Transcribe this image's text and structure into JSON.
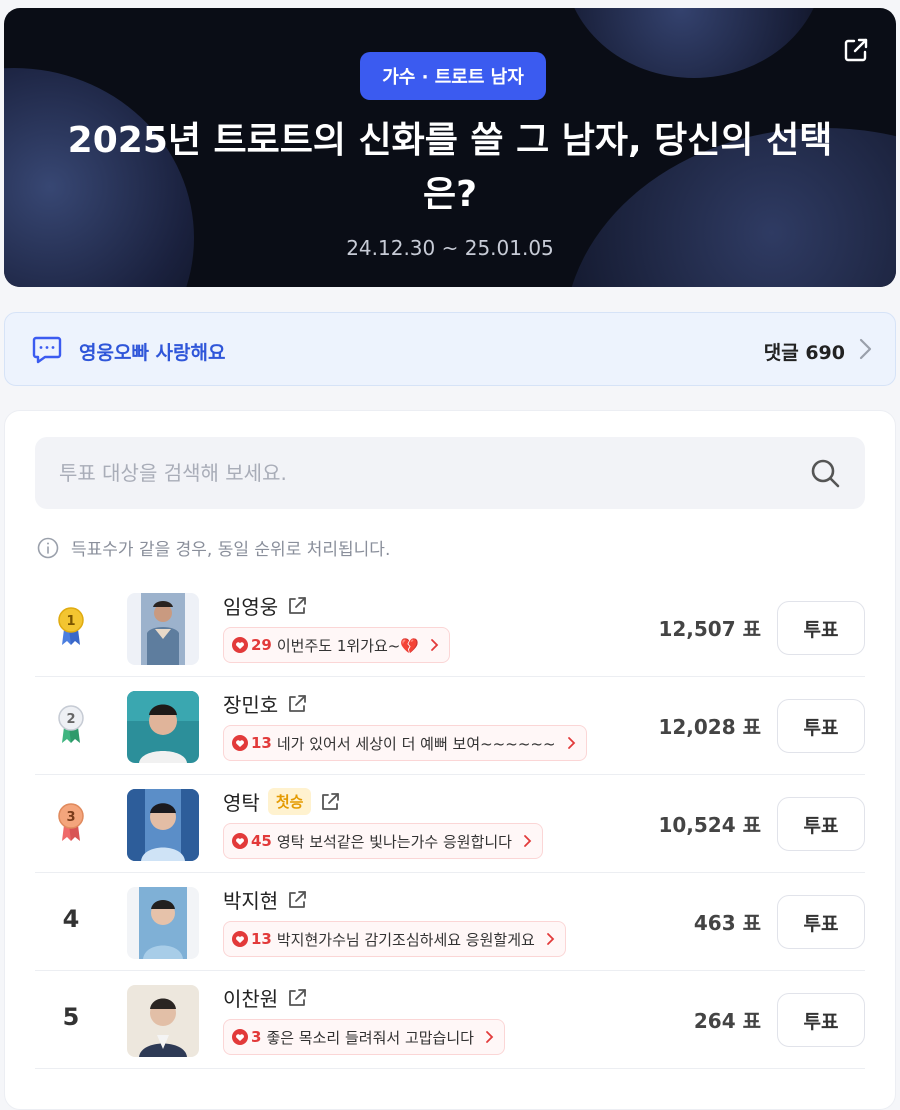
{
  "hero": {
    "category": "가수 · 트로트 남자",
    "title": "2025년 트로트의 신화를 쓸 그 남자, 당신의 선택은?",
    "dates": "24.12.30 ~ 25.01.05"
  },
  "comment_bar": {
    "message": "영웅오빠 사랑해요",
    "count_label": "댓글 690"
  },
  "search": {
    "placeholder": "투표 대상을 검색해 보세요."
  },
  "notice": "득표수가 같을 경우, 동일 순위로 처리됩니다.",
  "vote_label": "투표",
  "candidates": [
    {
      "rank": "1",
      "name": "임영웅",
      "badge": "",
      "comment_count": "29",
      "comment": "이번주도 1위가요~💔",
      "votes": "12,507 표",
      "medal_color": "#f3c531"
    },
    {
      "rank": "2",
      "name": "장민호",
      "badge": "",
      "comment_count": "13",
      "comment": "네가 있어서 세상이 더 예뻐 보여~~~~~~",
      "votes": "12,028 표",
      "medal_color": "#dfe3ea"
    },
    {
      "rank": "3",
      "name": "영탁",
      "badge": "첫승",
      "comment_count": "45",
      "comment": "영탁 보석같은 빛나는가수 응원합니다",
      "votes": "10,524 표",
      "medal_color": "#f4a57c"
    },
    {
      "rank": "4",
      "name": "박지현",
      "badge": "",
      "comment_count": "13",
      "comment": "박지현가수님 감기조심하세요 응원할게요",
      "votes": "463 표",
      "medal_color": ""
    },
    {
      "rank": "5",
      "name": "이찬원",
      "badge": "",
      "comment_count": "3",
      "comment": "좋은 목소리 들려줘서 고맙습니다",
      "votes": "264 표",
      "medal_color": ""
    }
  ],
  "colors": {
    "accent": "#3b5bf0",
    "comment_text": "#2f56d9",
    "heart": "#e23a3a",
    "ribbon": "#3fb580"
  }
}
